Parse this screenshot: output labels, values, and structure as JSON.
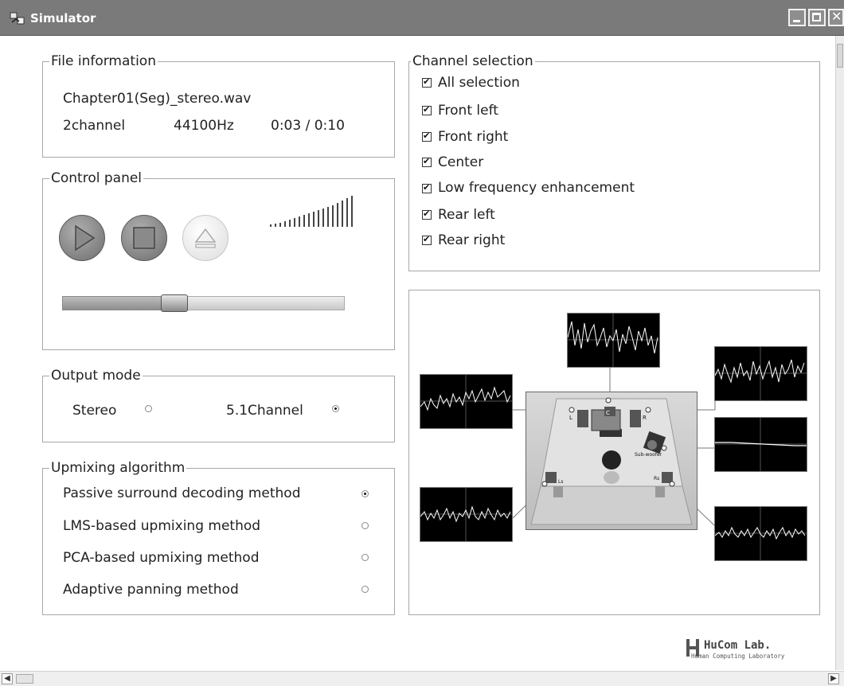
{
  "window": {
    "title": "Simulator",
    "buttons": {
      "minimize": "minimize-icon",
      "maximize": "maximize-icon",
      "close": "close-icon"
    }
  },
  "file_info": {
    "legend": "File information",
    "filename": "Chapter01(Seg)_stereo.wav",
    "channels": "2channel",
    "sample_rate": "44100Hz",
    "time": "0:03 / 0:10"
  },
  "control_panel": {
    "legend": "Control panel",
    "buttons": [
      "play-icon",
      "stop-icon",
      "eject-icon"
    ],
    "seek_position_fraction": 0.33,
    "volume_bars": 18
  },
  "output_mode": {
    "legend": "Output mode",
    "options": [
      {
        "label": "Stereo",
        "selected": false
      },
      {
        "label": "5.1Channel",
        "selected": true
      }
    ]
  },
  "upmixing": {
    "legend": "Upmixing algorithm",
    "options": [
      {
        "label": "Passive surround decoding method",
        "selected": true
      },
      {
        "label": "LMS-based upmixing method",
        "selected": false
      },
      {
        "label": "PCA-based upmixing method",
        "selected": false
      },
      {
        "label": "Adaptive panning method",
        "selected": false
      }
    ]
  },
  "channel_selection": {
    "legend": "Channel selection",
    "items": [
      {
        "label": "All selection",
        "checked": true
      },
      {
        "label": "Front left",
        "checked": true
      },
      {
        "label": "Front right",
        "checked": true
      },
      {
        "label": "Center",
        "checked": true
      },
      {
        "label": "Low frequency enhancement",
        "checked": true
      },
      {
        "label": "Rear left",
        "checked": true
      },
      {
        "label": "Rear right",
        "checked": true
      }
    ]
  },
  "speaker_diagram": {
    "labels": {
      "c": "C",
      "l": "L",
      "r": "R",
      "ls": "Ls",
      "rs": "Rs",
      "sub": "Sub-woofer"
    }
  },
  "logo": {
    "name": "HuCom Lab.",
    "subtitle": "Human Computing Laboratory"
  }
}
